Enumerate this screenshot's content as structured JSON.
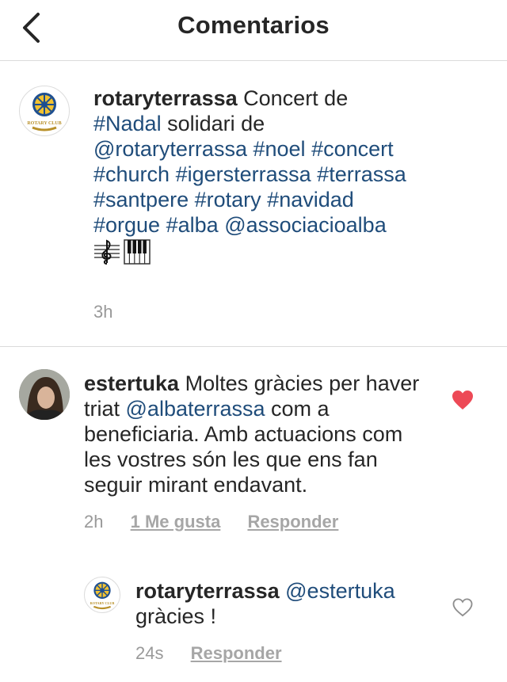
{
  "header": {
    "title": "Comentarios"
  },
  "caption": {
    "username": "rotaryterrassa",
    "segments": [
      {
        "t": "Concert de "
      },
      {
        "t": "#Nadal",
        "tag": true
      },
      {
        "t": " solidari de "
      },
      {
        "t": "@rotaryterrassa",
        "tag": true
      },
      {
        "t": " "
      },
      {
        "t": "#noel",
        "tag": true
      },
      {
        "t": " "
      },
      {
        "t": "#concert",
        "tag": true
      },
      {
        "t": " "
      },
      {
        "t": "#church",
        "tag": true
      },
      {
        "t": " "
      },
      {
        "t": "#igersterrassa",
        "tag": true
      },
      {
        "t": " "
      },
      {
        "t": "#terrassa",
        "tag": true
      },
      {
        "t": " "
      },
      {
        "t": "#santpere",
        "tag": true
      },
      {
        "t": " "
      },
      {
        "t": "#rotary",
        "tag": true
      },
      {
        "t": " "
      },
      {
        "t": "#navidad",
        "tag": true
      },
      {
        "t": " "
      },
      {
        "t": "#orgue",
        "tag": true
      },
      {
        "t": " "
      },
      {
        "t": "#alba",
        "tag": true
      },
      {
        "t": " "
      },
      {
        "t": "@associacioalba",
        "tag": true
      }
    ],
    "emojis": [
      "treble-clef-emoji",
      "piano-keys-emoji"
    ],
    "time": "3h"
  },
  "comment": {
    "username": "estertuka",
    "segments": [
      {
        "t": "Moltes gràcies per haver triat "
      },
      {
        "t": "@albaterrassa",
        "tag": true
      },
      {
        "t": " com a beneficiaria. Amb actuacions com les vostres són les que ens fan seguir mirant endavant."
      }
    ],
    "time": "2h",
    "likes": "1 Me gusta",
    "reply": "Responder",
    "liked": true
  },
  "reply": {
    "username": "rotaryterrassa",
    "segments": [
      {
        "t": "@estertuka",
        "tag": true
      },
      {
        "t": " gràcies !"
      }
    ],
    "time": "24s",
    "reply": "Responder",
    "liked": false
  },
  "colors": {
    "hashtag": "#1f4c7a",
    "heart": "#ed4956",
    "muted": "#999999",
    "text": "#262626"
  },
  "logo": {
    "text": "ROTARY CLUB"
  }
}
